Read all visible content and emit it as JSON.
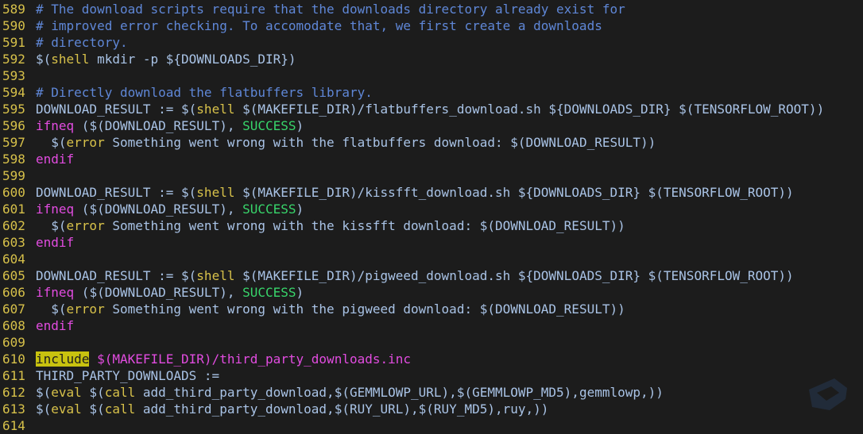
{
  "lines": [
    {
      "n": "589",
      "parts": [
        {
          "t": "# The download scripts require that the downloads directory already exist for",
          "k": "comment"
        }
      ]
    },
    {
      "n": "590",
      "parts": [
        {
          "t": "# improved error checking. To accomodate that, we first create a downloads",
          "k": "comment"
        }
      ]
    },
    {
      "n": "591",
      "parts": [
        {
          "t": "# directory.",
          "k": "comment"
        }
      ]
    },
    {
      "n": "592",
      "parts": [
        {
          "t": "$(",
          "k": "plain"
        },
        {
          "t": "shell",
          "k": "fn"
        },
        {
          "t": " mkdir -p ${DOWNLOADS_DIR})",
          "k": "plain"
        }
      ]
    },
    {
      "n": "593",
      "parts": []
    },
    {
      "n": "594",
      "parts": [
        {
          "t": "# Directly download the flatbuffers library.",
          "k": "comment"
        }
      ]
    },
    {
      "n": "595",
      "parts": [
        {
          "t": "DOWNLOAD_RESULT := $(",
          "k": "plain"
        },
        {
          "t": "shell",
          "k": "fn"
        },
        {
          "t": " $(MAKEFILE_DIR)/flatbuffers_download.sh ${DOWNLOADS_DIR} $(TENSORFLOW_ROOT))",
          "k": "plain"
        }
      ]
    },
    {
      "n": "596",
      "parts": [
        {
          "t": "ifneq",
          "k": "kw"
        },
        {
          "t": " ($(DOWNLOAD_RESULT), ",
          "k": "plain"
        },
        {
          "t": "SUCCESS",
          "k": "str"
        },
        {
          "t": ")",
          "k": "plain"
        }
      ]
    },
    {
      "n": "597",
      "parts": [
        {
          "t": "  $(",
          "k": "plain"
        },
        {
          "t": "error",
          "k": "fn"
        },
        {
          "t": " Something went wrong with the flatbuffers download: $(DOWNLOAD_RESULT))",
          "k": "plain"
        }
      ]
    },
    {
      "n": "598",
      "parts": [
        {
          "t": "endif",
          "k": "kw"
        }
      ]
    },
    {
      "n": "599",
      "parts": []
    },
    {
      "n": "600",
      "parts": [
        {
          "t": "DOWNLOAD_RESULT := $(",
          "k": "plain"
        },
        {
          "t": "shell",
          "k": "fn"
        },
        {
          "t": " $(MAKEFILE_DIR)/kissfft_download.sh ${DOWNLOADS_DIR} $(TENSORFLOW_ROOT))",
          "k": "plain"
        }
      ]
    },
    {
      "n": "601",
      "parts": [
        {
          "t": "ifneq",
          "k": "kw"
        },
        {
          "t": " ($(DOWNLOAD_RESULT), ",
          "k": "plain"
        },
        {
          "t": "SUCCESS",
          "k": "str"
        },
        {
          "t": ")",
          "k": "plain"
        }
      ]
    },
    {
      "n": "602",
      "parts": [
        {
          "t": "  $(",
          "k": "plain"
        },
        {
          "t": "error",
          "k": "fn"
        },
        {
          "t": " Something went wrong with the kissfft download: $(DOWNLOAD_RESULT))",
          "k": "plain"
        }
      ]
    },
    {
      "n": "603",
      "parts": [
        {
          "t": "endif",
          "k": "kw"
        }
      ]
    },
    {
      "n": "604",
      "parts": []
    },
    {
      "n": "605",
      "parts": [
        {
          "t": "DOWNLOAD_RESULT := $(",
          "k": "plain"
        },
        {
          "t": "shell",
          "k": "fn"
        },
        {
          "t": " $(MAKEFILE_DIR)/pigweed_download.sh ${DOWNLOADS_DIR} $(TENSORFLOW_ROOT))",
          "k": "plain"
        }
      ]
    },
    {
      "n": "606",
      "parts": [
        {
          "t": "ifneq",
          "k": "kw"
        },
        {
          "t": " ($(DOWNLOAD_RESULT), ",
          "k": "plain"
        },
        {
          "t": "SUCCESS",
          "k": "str"
        },
        {
          "t": ")",
          "k": "plain"
        }
      ]
    },
    {
      "n": "607",
      "parts": [
        {
          "t": "  $(",
          "k": "plain"
        },
        {
          "t": "error",
          "k": "fn"
        },
        {
          "t": " Something went wrong with the pigweed download: $(DOWNLOAD_RESULT))",
          "k": "plain"
        }
      ]
    },
    {
      "n": "608",
      "parts": [
        {
          "t": "endif",
          "k": "kw"
        }
      ]
    },
    {
      "n": "609",
      "parts": []
    },
    {
      "n": "610",
      "parts": [
        {
          "t": "include",
          "k": "hl"
        },
        {
          "t": " $(MAKEFILE_DIR)/third_party_downloads.inc",
          "k": "kw"
        }
      ]
    },
    {
      "n": "611",
      "parts": [
        {
          "t": "THIRD_PARTY_DOWNLOADS :=",
          "k": "plain"
        }
      ]
    },
    {
      "n": "612",
      "parts": [
        {
          "t": "$(",
          "k": "plain"
        },
        {
          "t": "eval",
          "k": "fn"
        },
        {
          "t": " $(",
          "k": "plain"
        },
        {
          "t": "call",
          "k": "fn"
        },
        {
          "t": " add_third_party_download,$(GEMMLOWP_URL),$(GEMMLOWP_MD5),gemmlowp,))",
          "k": "plain"
        }
      ]
    },
    {
      "n": "613",
      "parts": [
        {
          "t": "$(",
          "k": "plain"
        },
        {
          "t": "eval",
          "k": "fn"
        },
        {
          "t": " $(",
          "k": "plain"
        },
        {
          "t": "call",
          "k": "fn"
        },
        {
          "t": " add_third_party_download,$(RUY_URL),$(RUY_MD5),ruy,))",
          "k": "plain"
        }
      ]
    },
    {
      "n": "614",
      "parts": []
    }
  ],
  "colors": {
    "background": "#1c1c1c",
    "line_number": "#d7c14a",
    "comment": "#5f87d7",
    "plain": "#a9c3e6",
    "keyword": "#e24ce0",
    "function": "#d7c14a",
    "string": "#38d66b",
    "highlight": "#c8c20f"
  },
  "icons": {
    "watermark": "logo-watermark-icon"
  }
}
